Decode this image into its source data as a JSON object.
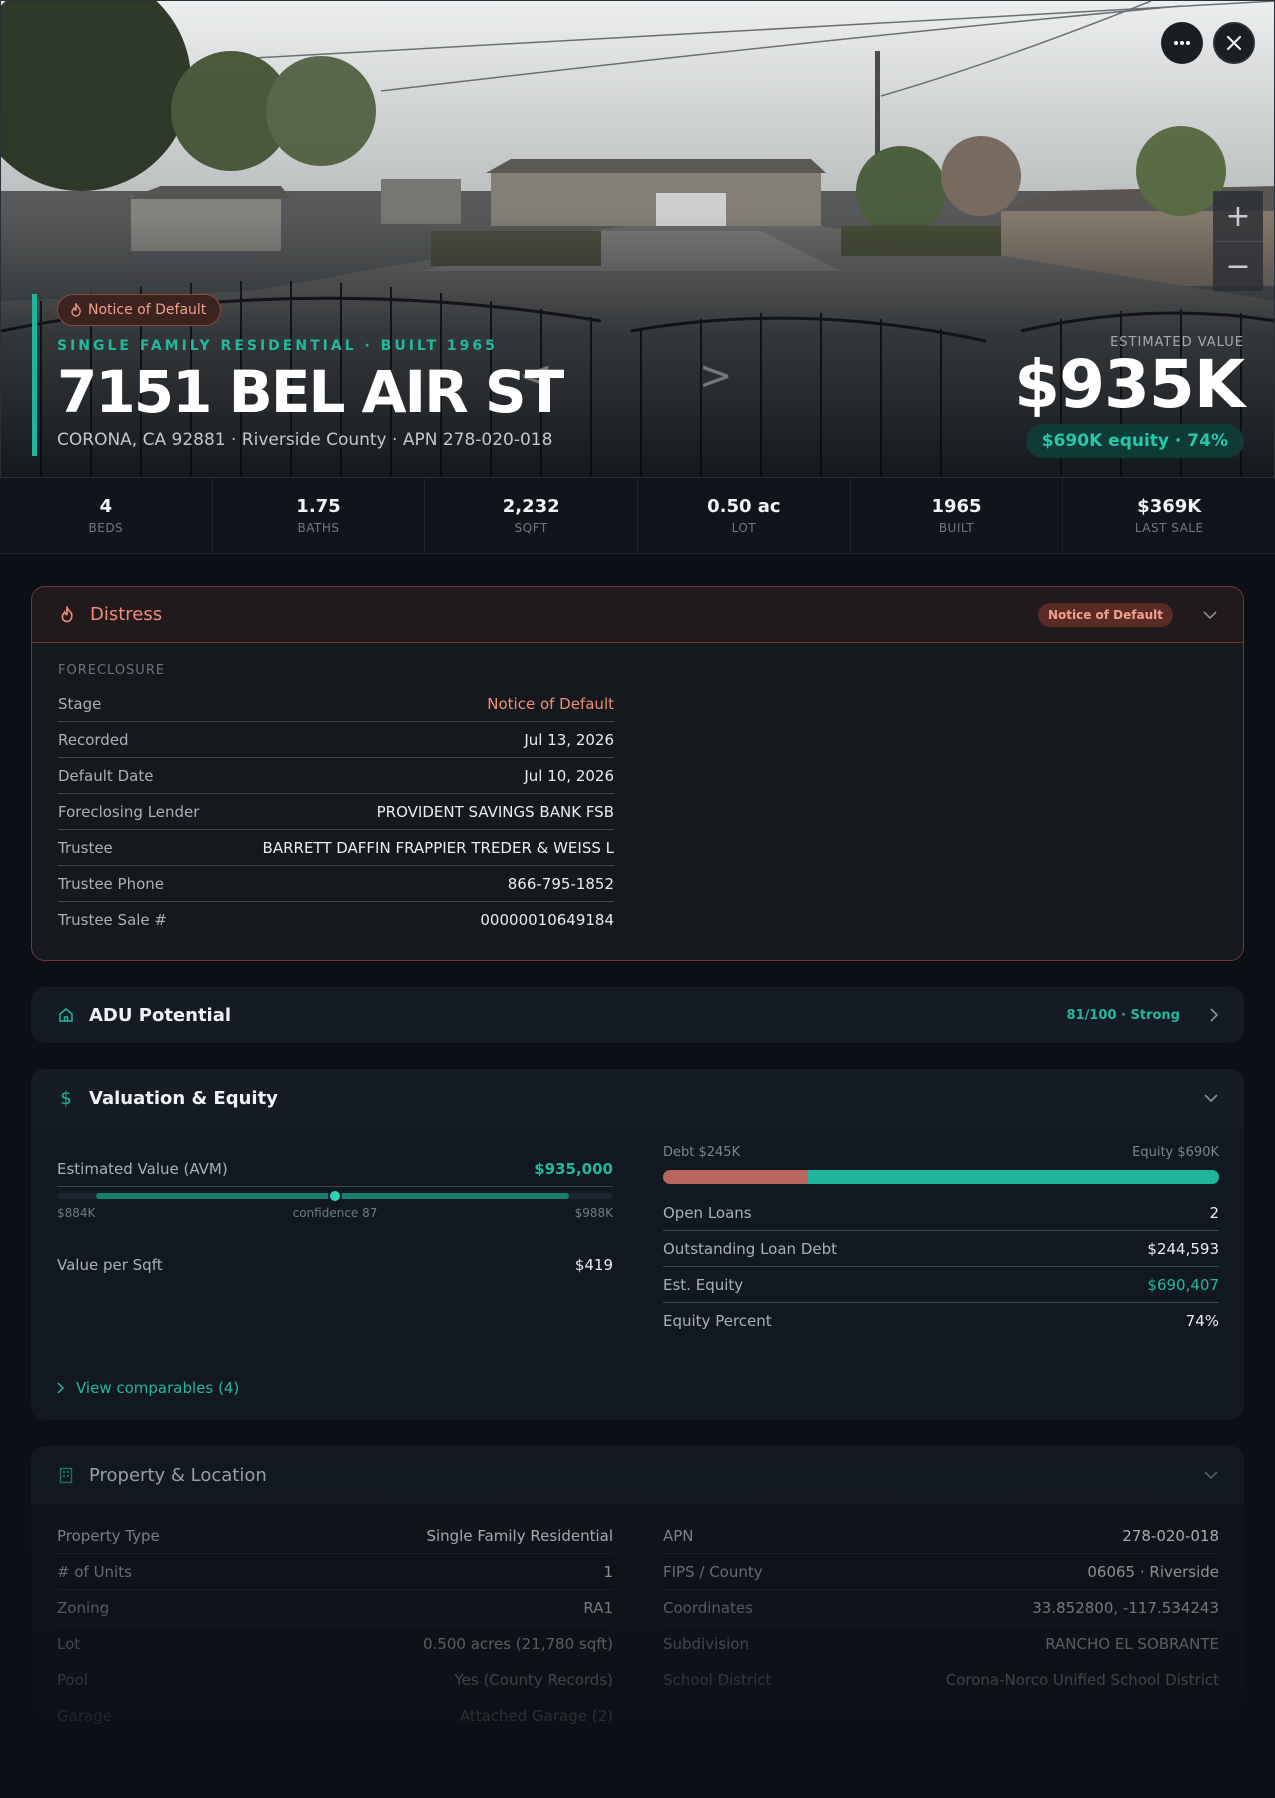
{
  "hero": {
    "status_pill": "Notice of Default",
    "meta": "SINGLE FAMILY RESIDENTIAL · BUILT 1965",
    "address": "7151 BEL AIR ST",
    "sub": "CORONA, CA 92881 · Riverside County · APN 278-020-018",
    "estimated_label": "ESTIMATED VALUE",
    "estimated_value": "$935K",
    "equity_pill": "$690K equity · 74%",
    "gallery_prev": "<",
    "gallery_next": ">",
    "zoom_in": "+",
    "zoom_out": "−"
  },
  "stats": [
    {
      "value": "4",
      "label": "BEDS"
    },
    {
      "value": "1.75",
      "label": "BATHS"
    },
    {
      "value": "2,232",
      "label": "SQFT"
    },
    {
      "value": "0.50 ac",
      "label": "LOT"
    },
    {
      "value": "1965",
      "label": "BUILT"
    },
    {
      "value": "$369K",
      "label": "LAST SALE"
    }
  ],
  "distress": {
    "title": "Distress",
    "badge": "Notice of Default",
    "caption": "FORECLOSURE",
    "rows": [
      {
        "label": "Stage",
        "value": "Notice of Default"
      },
      {
        "label": "Recorded",
        "value": "Jul 13, 2026"
      },
      {
        "label": "Default Date",
        "value": "Jul 10, 2026"
      },
      {
        "label": "Foreclosing Lender",
        "value": "PROVIDENT SAVINGS BANK FSB"
      },
      {
        "label": "Trustee",
        "value": "BARRETT DAFFIN FRAPPIER TREDER & WEISS L"
      },
      {
        "label": "Trustee Phone",
        "value": "866-795-1852"
      },
      {
        "label": "Trustee Sale #",
        "value": "00000010649184"
      }
    ]
  },
  "adu": {
    "title": "ADU Potential",
    "score": "81/100 · Strong"
  },
  "valuation": {
    "title": "Valuation & Equity",
    "avm_label": "Estimated Value (AVM)",
    "avm_value": "$935,000",
    "range_low": "$884K",
    "range_high": "$988K",
    "confidence": "confidence 87",
    "vps_label": "Value per Sqft",
    "vps_value": "$419",
    "debt_label": "Debt $245K",
    "equity_label": "Equity $690K",
    "equity_fraction": 0.74,
    "loans": [
      {
        "label": "Open Loans",
        "value": "2"
      },
      {
        "label": "Outstanding Loan Debt",
        "value": "$244,593"
      },
      {
        "label": "Est. Equity",
        "value": "$690,407"
      },
      {
        "label": "Equity Percent",
        "value": "74%"
      }
    ],
    "comps_link": "View comparables (4)"
  },
  "property": {
    "title": "Property & Location",
    "left": [
      {
        "label": "Property Type",
        "value": "Single Family Residential"
      },
      {
        "label": "# of Units",
        "value": "1"
      },
      {
        "label": "Zoning",
        "value": "RA1"
      },
      {
        "label": "Lot",
        "value": "0.500 acres (21,780 sqft)"
      },
      {
        "label": "Pool",
        "value": "Yes (County Records)"
      },
      {
        "label": "Garage",
        "value": "Attached Garage (2)"
      }
    ],
    "right": [
      {
        "label": "APN",
        "value": "278-020-018"
      },
      {
        "label": "FIPS / County",
        "value": "06065 · Riverside"
      },
      {
        "label": "Coordinates",
        "value": "33.852800, -117.534243"
      },
      {
        "label": "Subdivision",
        "value": "RANCHO EL SOBRANTE"
      },
      {
        "label": "School District",
        "value": "Corona-Norco Unified School District"
      }
    ]
  },
  "colors": {
    "accent": "#1fb59d",
    "distress": "#f08d78",
    "debt": "#b9665d"
  }
}
